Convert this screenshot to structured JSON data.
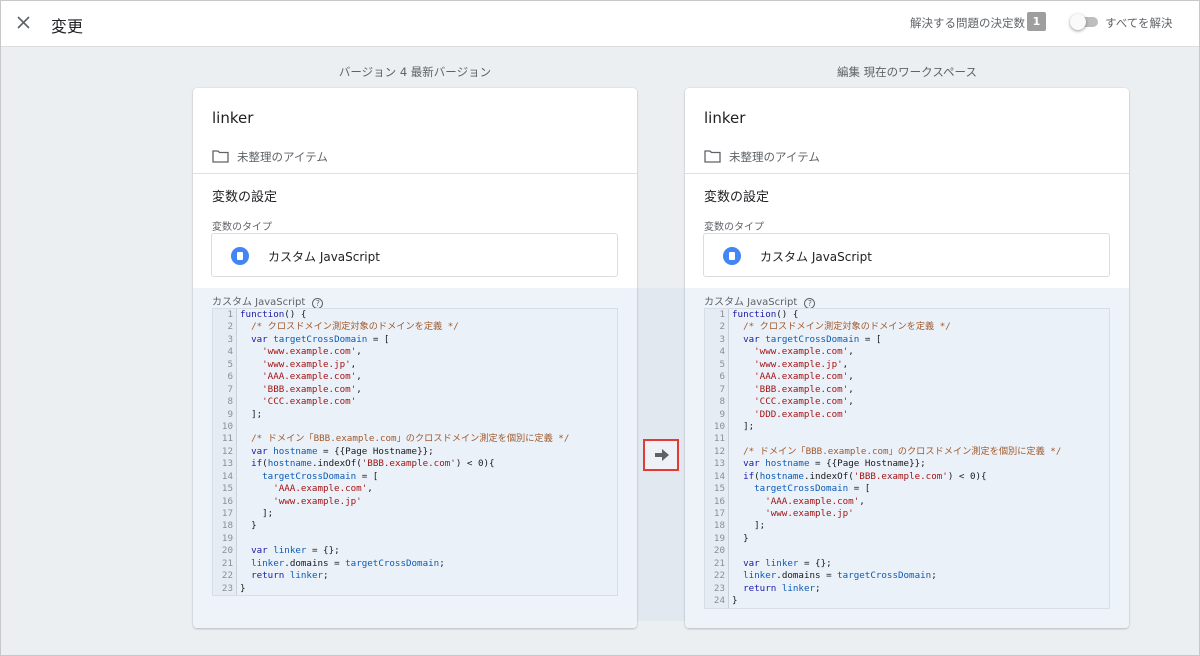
{
  "header": {
    "title": "変更",
    "issues_label": "解決する問題の決定数",
    "issues_count": "1",
    "resolve_all_label": "すべてを解決",
    "resolve_all_on": false
  },
  "left": {
    "caption": "バージョン 4  最新バージョン",
    "name": "linker",
    "folder": "未整理のアイテム",
    "section_title": "変数の設定",
    "type_caption": "変数のタイプ",
    "type_label": "カスタム JavaScript",
    "code_caption": "カスタム JavaScript",
    "code": [
      "function() {",
      "  /* クロスドメイン測定対象のドメインを定義 */",
      "  var targetCrossDomain = [",
      "    'www.example.com',",
      "    'www.example.jp',",
      "    'AAA.example.com',",
      "    'BBB.example.com',",
      "    'CCC.example.com'",
      "  ];",
      "",
      "  /* ドメイン「BBB.example.com」のクロスドメイン測定を個別に定義 */",
      "  var hostname = {{Page Hostname}};",
      "  if(hostname.indexOf('BBB.example.com') < 0){",
      "    targetCrossDomain = [",
      "      'AAA.example.com',",
      "      'www.example.jp'",
      "    ];",
      "  }",
      "",
      "  var linker = {};",
      "  linker.domains = targetCrossDomain;",
      "  return linker;",
      "}"
    ]
  },
  "right": {
    "caption": "編集  現在のワークスペース",
    "name": "linker",
    "folder": "未整理のアイテム",
    "section_title": "変数の設定",
    "type_caption": "変数のタイプ",
    "type_label": "カスタム JavaScript",
    "code_caption": "カスタム JavaScript",
    "code": [
      "function() {",
      "  /* クロスドメイン測定対象のドメインを定義 */",
      "  var targetCrossDomain = [",
      "    'www.example.com',",
      "    'www.example.jp',",
      "    'AAA.example.com',",
      "    'BBB.example.com',",
      "    'CCC.example.com',",
      "    'DDD.example.com'",
      "  ];",
      "",
      "  /* ドメイン「BBB.example.com」のクロスドメイン測定を個別に定義 */",
      "  var hostname = {{Page Hostname}};",
      "  if(hostname.indexOf('BBB.example.com') < 0){",
      "    targetCrossDomain = [",
      "      'AAA.example.com',",
      "      'www.example.jp'",
      "    ];",
      "  }",
      "",
      "  var linker = {};",
      "  linker.domains = targetCrossDomain;",
      "  return linker;",
      "}"
    ]
  },
  "icons": {
    "close": "close-icon",
    "folder": "folder-icon",
    "variable_type": "custom-javascript-icon",
    "help": "help-icon",
    "arrow": "arrow-right-icon"
  },
  "colors": {
    "accent": "#4285f4",
    "arrow_border": "#e53935",
    "badge": "#9e9e9e"
  }
}
